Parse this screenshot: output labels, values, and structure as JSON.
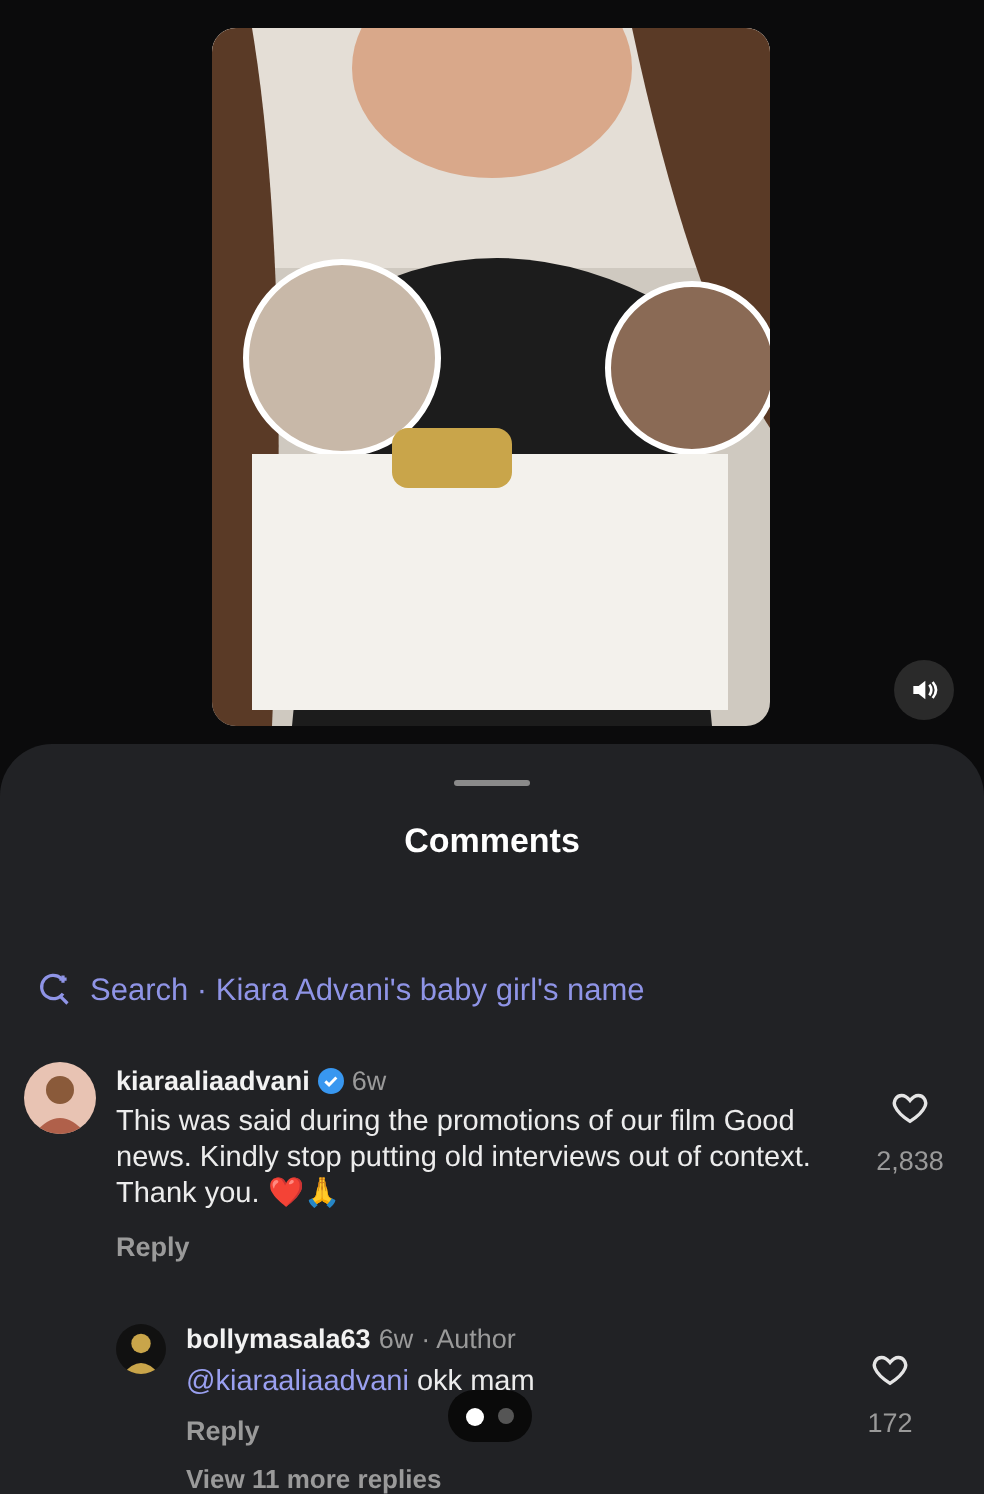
{
  "post": {
    "sound_button": {
      "muted": false
    }
  },
  "comments_sheet": {
    "title": "Comments",
    "search": {
      "text": "Search · Kiara Advani's baby girl's name"
    },
    "comments": [
      {
        "username": "kiaraaliaadvani",
        "verified": true,
        "time": "6w",
        "text": "This was said during the promotions of our film Good news. Kindly stop putting old interviews out of context. Thank you. ❤️🙏",
        "likes": "2,838",
        "reply": "Reply",
        "replies": [
          {
            "username": "bollymasala63",
            "verified": false,
            "time": "6w",
            "badge": "· Author",
            "mention": "@kiaraaliaadvani",
            "text": "okk mam",
            "likes": "172",
            "reply": "Reply"
          }
        ],
        "view_more": "View 11 more replies"
      }
    ],
    "carousel_dots": [
      {
        "selected": true
      },
      {
        "selected": false
      }
    ]
  }
}
